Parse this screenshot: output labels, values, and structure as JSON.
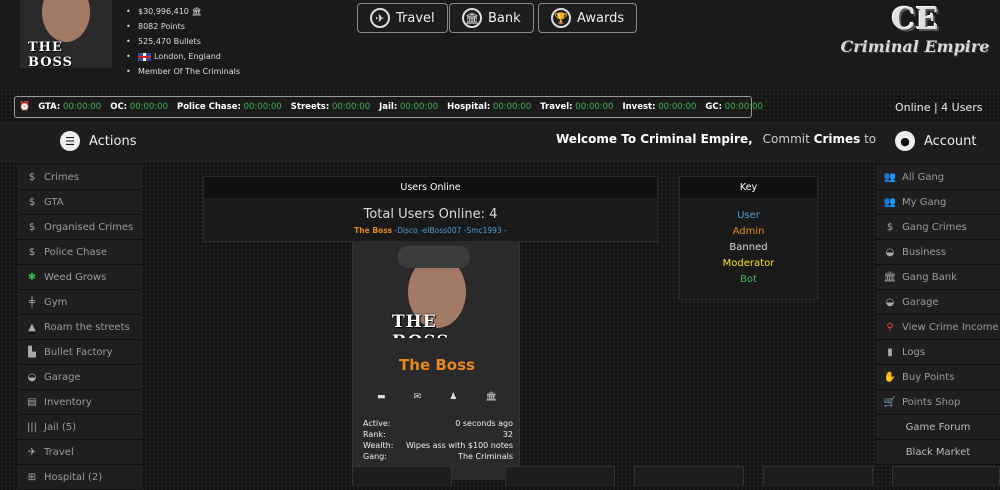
{
  "header": {
    "avatar_caption": "THE BOSS",
    "stats": {
      "money": "$30,996,410",
      "points": "8082 Points",
      "bullets": "525,470 Bullets",
      "location": "London, England",
      "member_of_prefix": "Member Of",
      "member_of_gang": "The Criminals"
    },
    "nav": [
      {
        "label": "Travel",
        "icon": "airplane-icon"
      },
      {
        "label": "Bank",
        "icon": "bank-icon"
      },
      {
        "label": "Awards",
        "icon": "trophy-icon"
      }
    ],
    "logo_mark": "CE",
    "logo_text": "Criminal Empire"
  },
  "timers": [
    {
      "label": "GTA:",
      "value": "00:00:00"
    },
    {
      "label": "OC:",
      "value": "00:00:00"
    },
    {
      "label": "Police Chase:",
      "value": "00:00:00"
    },
    {
      "label": "Streets:",
      "value": "00:00:00"
    },
    {
      "label": "Jail:",
      "value": "00:00:00"
    },
    {
      "label": "Hospital:",
      "value": "00:00:00"
    },
    {
      "label": "Travel:",
      "value": "00:00:00"
    },
    {
      "label": "Invest:",
      "value": "00:00:00"
    },
    {
      "label": "GC:",
      "value": "00:00:00"
    }
  ],
  "online_users": "Online | 4 Users",
  "actions_title": "Actions",
  "account_title": "Account",
  "welcome": {
    "bold": "Welcome To Criminal Empire,",
    "text": "Commit",
    "bold2": "Crimes",
    "tail": "to"
  },
  "left_menu": [
    {
      "label": "Crimes",
      "icon": "dollar-icon"
    },
    {
      "label": "GTA",
      "icon": "dollar-icon"
    },
    {
      "label": "Organised Crimes",
      "icon": "dollar-icon"
    },
    {
      "label": "Police Chase",
      "icon": "dollar-icon"
    },
    {
      "label": "Weed Grows",
      "icon": "leaf-icon"
    },
    {
      "label": "Gym",
      "icon": "dumbbell-icon"
    },
    {
      "label": "Roam the streets",
      "icon": "road-icon"
    },
    {
      "label": "Bullet Factory",
      "icon": "factory-icon"
    },
    {
      "label": "Garage",
      "icon": "car-icon"
    },
    {
      "label": "Inventory",
      "icon": "boxes-icon"
    },
    {
      "label": "Jail (5)",
      "icon": "bars-icon"
    },
    {
      "label": "Travel",
      "icon": "plane-icon"
    },
    {
      "label": "Hospital (2)",
      "icon": "hospital-icon"
    }
  ],
  "right_menu": [
    {
      "label": "All Gang",
      "icon": "users-icon"
    },
    {
      "label": "My Gang",
      "icon": "users-icon"
    },
    {
      "label": "Gang Crimes",
      "icon": "dollar-icon"
    },
    {
      "label": "Business",
      "icon": "car-icon"
    },
    {
      "label": "Gang Bank",
      "icon": "bank-icon"
    },
    {
      "label": "Garage",
      "icon": "car-icon"
    },
    {
      "label": "View Crime Income",
      "icon": "search-dollar-icon"
    },
    {
      "label": "Logs",
      "icon": "file-icon"
    },
    {
      "label": "Buy Points",
      "icon": "hand-icon"
    },
    {
      "label": "Points Shop",
      "icon": "cart-icon"
    },
    {
      "label": "Game Forum",
      "icon": ""
    },
    {
      "label": "Black Market",
      "icon": ""
    }
  ],
  "users_online": {
    "title": "Users Online",
    "total": "Total Users Online: 4",
    "names": [
      {
        "name": "The Boss",
        "role": "admin"
      },
      {
        "name": "Disco",
        "role": "user"
      },
      {
        "name": "elBoss007",
        "role": "user"
      },
      {
        "name": "Smc1993",
        "role": "user"
      }
    ]
  },
  "key": {
    "title": "Key",
    "entries": [
      {
        "label": "User",
        "color": "#4a9fd6"
      },
      {
        "label": "Admin",
        "color": "#e8861c"
      },
      {
        "label": "Banned",
        "color": "#dddddd"
      },
      {
        "label": "Moderator",
        "color": "#f5e12a"
      },
      {
        "label": "Bot",
        "color": "#3fb24f"
      }
    ]
  },
  "profile": {
    "caption": "THE BOSS",
    "name": "The Boss",
    "icons": [
      "comment-icon",
      "mail-icon",
      "user-icon",
      "bank-icon"
    ],
    "rows": [
      {
        "label": "Active:",
        "value": "0 seconds ago"
      },
      {
        "label": "Rank:",
        "value": "32"
      },
      {
        "label": "Wealth:",
        "value": "Wipes ass with $100 notes"
      },
      {
        "label": "Gang:",
        "value": "The Criminals"
      }
    ]
  }
}
